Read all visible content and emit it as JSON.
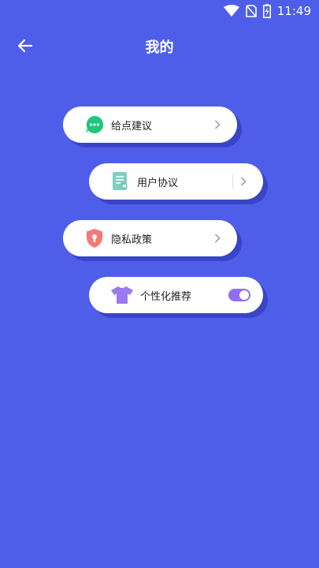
{
  "status_bar": {
    "time": "11:49",
    "icons": [
      "wifi-icon",
      "no-sim-icon",
      "battery-charging-icon"
    ]
  },
  "header": {
    "title": "我的",
    "back_icon": "arrow-left-icon"
  },
  "menu": {
    "items": [
      {
        "label": "给点建议",
        "icon": "chat-bubble-icon",
        "icon_color": "#1dc87a",
        "trailing": "chevron"
      },
      {
        "label": "用户协议",
        "icon": "document-icon",
        "icon_color": "#7ccfc3",
        "trailing": "chevron"
      },
      {
        "label": "隐私政策",
        "icon": "shield-icon",
        "icon_color": "#f57878",
        "trailing": "chevron"
      },
      {
        "label": "个性化推荐",
        "icon": "tshirt-icon",
        "icon_color": "#9b7af0",
        "trailing": "toggle",
        "toggle_on": true
      }
    ]
  },
  "colors": {
    "background": "#4f5ee9",
    "card": "#ffffff",
    "card_shadow": "#2832aa",
    "toggle_on": "#8f6ff0"
  }
}
